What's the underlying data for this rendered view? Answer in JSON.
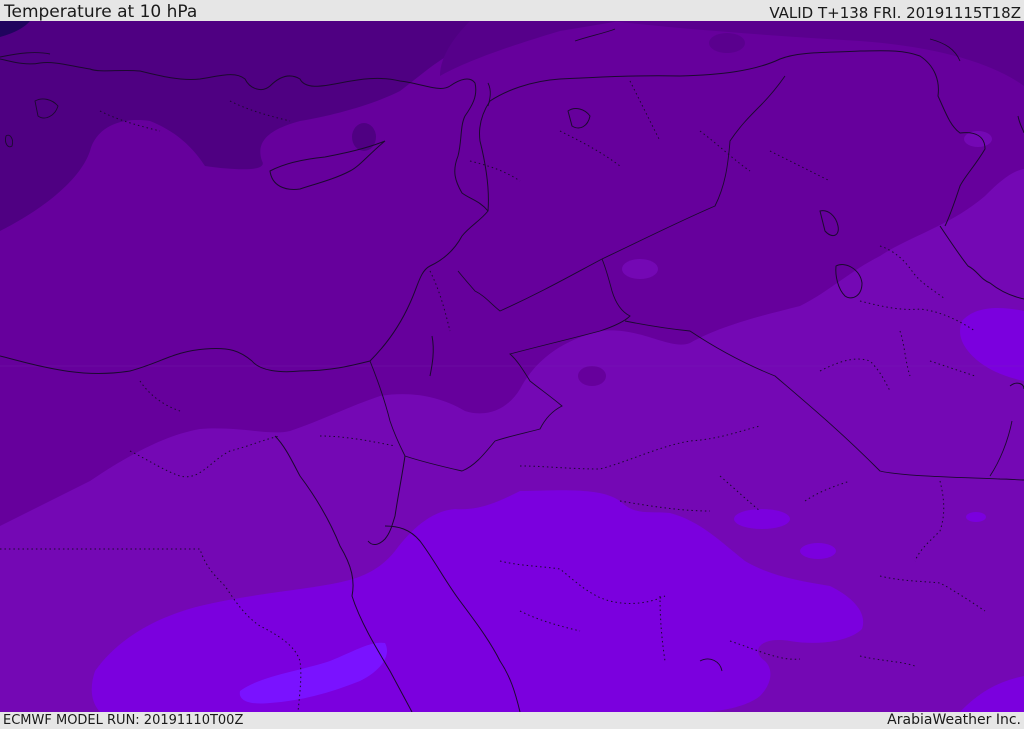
{
  "header": {
    "title": "Temperature at 10 hPa",
    "valid": "VALID T+138 FRI. 20191115T18Z"
  },
  "footer": {
    "model_run": "ECMWF MODEL RUN: 20191110T00Z",
    "credit": "ArabiaWeather Inc."
  },
  "colors": {
    "band_darkest": "#20045e",
    "band_dark": "#4f0082",
    "band_mid": "#66009c",
    "band_light": "#7408b4",
    "band_bright": "#7b00de",
    "band_brightest": "#7a12ff",
    "coastline": "#1c0930"
  }
}
